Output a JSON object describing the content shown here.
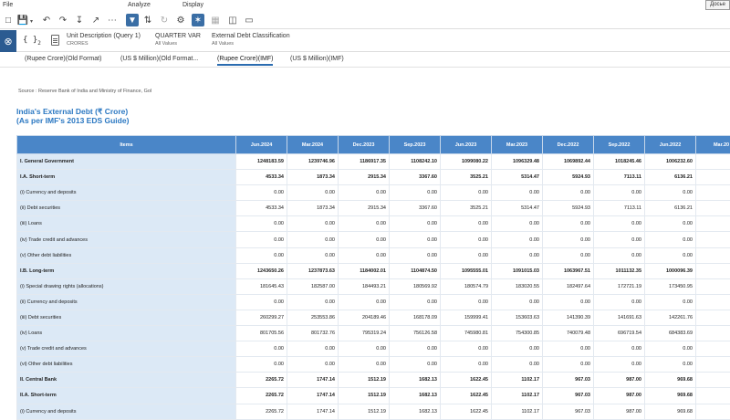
{
  "menu": {
    "file": "File",
    "analyze": "Analyze",
    "display": "Display",
    "user_button": "Досье"
  },
  "toolbar_icons": [
    "new-icon",
    "save-icon",
    "undo-icon",
    "redo-icon",
    "download-icon",
    "share-icon",
    "more-icon",
    "filter-icon",
    "swap-icon",
    "refresh-icon",
    "settings-icon",
    "pin-icon",
    "table-icon",
    "chart-icon",
    "monitor-icon"
  ],
  "info": {
    "side_icon": "⊗",
    "braces": "{ }",
    "braces_count": "2",
    "dims": [
      {
        "label": "Unit Description (Query 1)",
        "value": "CRORES"
      },
      {
        "label": "QUARTER VAR",
        "value": "All Values"
      },
      {
        "label": "External Debt Classification",
        "value": "All Values"
      }
    ]
  },
  "tabs": [
    {
      "label": "(Rupee Crore)(Old Format)",
      "active": false
    },
    {
      "label": "(US $ Million)(Old Format...",
      "active": false
    },
    {
      "label": "(Rupee Crore)(IMF)",
      "active": true
    },
    {
      "label": "(US $ Million)(IMF)",
      "active": false
    }
  ],
  "report": {
    "source": "Source : Reserve Bank of India and Ministry of Finance, GoI",
    "title_line1": "India's External Debt (₹ Crore)",
    "title_line2": "(As per IMF's 2013 EDS Guide)"
  },
  "table": {
    "headers": [
      "Items",
      "Jun.2024",
      "Mar.2024",
      "Dec.2023",
      "Sep.2023",
      "Jun.2023",
      "Mar.2023",
      "Dec.2022",
      "Sep.2022",
      "Jun.2022",
      "Mar.20"
    ],
    "rows": [
      {
        "label": "I. General Government",
        "bold": true,
        "values": [
          "1248183.59",
          "1239746.96",
          "1186917.35",
          "1108242.10",
          "1099080.22",
          "1096329.48",
          "1069892.44",
          "1018245.46",
          "1006232.60",
          "993"
        ]
      },
      {
        "label": "I.A. Short-term",
        "bold": true,
        "values": [
          "4533.34",
          "1873.34",
          "2915.34",
          "3367.60",
          "3525.21",
          "5314.47",
          "5924.93",
          "7113.11",
          "6136.21",
          "6"
        ]
      },
      {
        "label": "(i) Currency and deposits",
        "bold": false,
        "values": [
          "0.00",
          "0.00",
          "0.00",
          "0.00",
          "0.00",
          "0.00",
          "0.00",
          "0.00",
          "0.00",
          ""
        ]
      },
      {
        "label": "(ii) Debt securities",
        "bold": false,
        "values": [
          "4533.34",
          "1873.34",
          "2915.34",
          "3367.60",
          "3525.21",
          "5314.47",
          "5924.93",
          "7113.11",
          "6136.21",
          "6"
        ]
      },
      {
        "label": "(iii) Loans",
        "bold": false,
        "values": [
          "0.00",
          "0.00",
          "0.00",
          "0.00",
          "0.00",
          "0.00",
          "0.00",
          "0.00",
          "0.00",
          ""
        ]
      },
      {
        "label": "(iv) Trade credit and advances",
        "bold": false,
        "values": [
          "0.00",
          "0.00",
          "0.00",
          "0.00",
          "0.00",
          "0.00",
          "0.00",
          "0.00",
          "0.00",
          ""
        ]
      },
      {
        "label": "(v) Other debt liabilities",
        "bold": false,
        "values": [
          "0.00",
          "0.00",
          "0.00",
          "0.00",
          "0.00",
          "0.00",
          "0.00",
          "0.00",
          "0.00",
          ""
        ]
      },
      {
        "label": "I.B. Long-term",
        "bold": true,
        "values": [
          "1243650.26",
          "1237873.63",
          "1184002.01",
          "1104874.50",
          "1095555.01",
          "1091015.03",
          "1063967.51",
          "1011132.35",
          "1000096.39",
          "986"
        ]
      },
      {
        "label": "(i) Special drawing rights (allocations)",
        "bold": false,
        "values": [
          "181645.43",
          "182587.00",
          "184493.21",
          "180569.92",
          "180574.79",
          "183020.55",
          "182497.64",
          "172721.19",
          "173450.95",
          "173"
        ]
      },
      {
        "label": "(ii) Currency and deposits",
        "bold": false,
        "values": [
          "0.00",
          "0.00",
          "0.00",
          "0.00",
          "0.00",
          "0.00",
          "0.00",
          "0.00",
          "0.00",
          ""
        ]
      },
      {
        "label": "(iii) Debt securities",
        "bold": false,
        "values": [
          "260299.27",
          "253553.86",
          "204189.46",
          "168178.09",
          "159999.41",
          "153603.63",
          "141390.39",
          "141691.63",
          "142261.76",
          "148"
        ]
      },
      {
        "label": "(iv) Loans",
        "bold": false,
        "values": [
          "801705.56",
          "801732.76",
          "795319.24",
          "756126.58",
          "745980.81",
          "754300.85",
          "740079.48",
          "696719.54",
          "684383.69",
          "664"
        ]
      },
      {
        "label": "(v) Trade credit and advances",
        "bold": false,
        "values": [
          "0.00",
          "0.00",
          "0.00",
          "0.00",
          "0.00",
          "0.00",
          "0.00",
          "0.00",
          "0.00",
          ""
        ]
      },
      {
        "label": "(vi) Other debt liabilities",
        "bold": false,
        "values": [
          "0.00",
          "0.00",
          "0.00",
          "0.00",
          "0.00",
          "0.00",
          "0.00",
          "0.00",
          "0.00",
          ""
        ]
      },
      {
        "label": "II. Central Bank",
        "bold": true,
        "values": [
          "2265.72",
          "1747.14",
          "1512.19",
          "1682.13",
          "1622.45",
          "1102.17",
          "967.03",
          "987.00",
          "969.68",
          ""
        ]
      },
      {
        "label": "II.A. Short-term",
        "bold": true,
        "values": [
          "2265.72",
          "1747.14",
          "1512.19",
          "1682.13",
          "1622.45",
          "1102.17",
          "967.03",
          "987.00",
          "969.68",
          ""
        ]
      },
      {
        "label": "(i) Currency and deposits",
        "bold": false,
        "values": [
          "2265.72",
          "1747.14",
          "1512.19",
          "1682.13",
          "1622.45",
          "1102.17",
          "967.03",
          "987.00",
          "969.68",
          ""
        ]
      },
      {
        "label": "(ii) Debt securities",
        "bold": false,
        "values": [
          "0.00",
          "0.00",
          "0.00",
          "0.00",
          "0.00",
          "0.00",
          "0.00",
          "0.00",
          "0.00",
          ""
        ]
      }
    ]
  }
}
